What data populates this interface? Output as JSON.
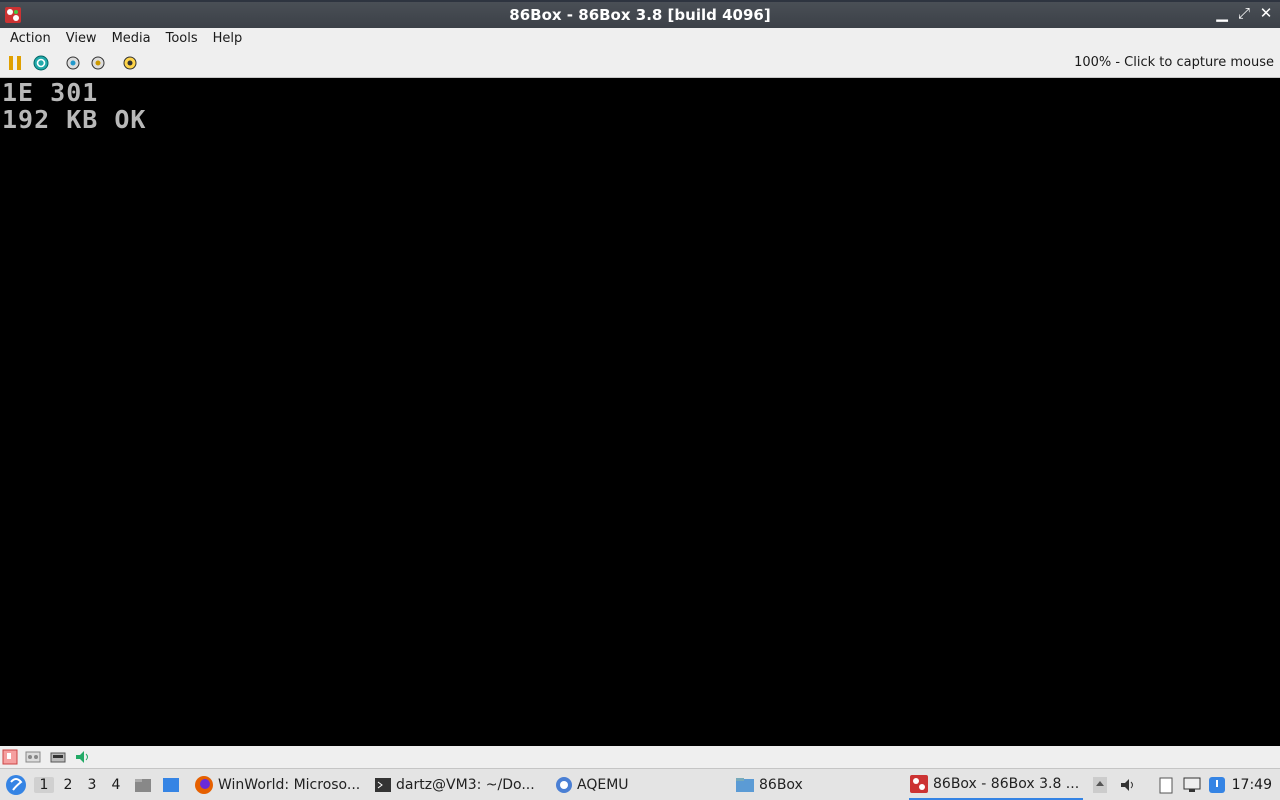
{
  "window": {
    "title": "86Box - 86Box 3.8 [build 4096]"
  },
  "menu": [
    "Action",
    "View",
    "Media",
    "Tools",
    "Help"
  ],
  "toolbar": {
    "status": "100% - Click to capture mouse"
  },
  "screen": {
    "lines": [
      "1E 301",
      "192 KB OK"
    ]
  },
  "taskbar": {
    "workspaces": [
      "1",
      "2",
      "3",
      "4"
    ],
    "active_workspace": "1",
    "tasks": [
      {
        "label": "WinWorld: Microso...",
        "icon": "firefox-icon"
      },
      {
        "label": "dartz@VM3: ~/Do...",
        "icon": "terminal-icon"
      },
      {
        "label": "AQEMU",
        "icon": "aqemu-icon"
      },
      {
        "label": "86Box",
        "icon": "folder-icon"
      },
      {
        "label": "86Box - 86Box 3.8 ...",
        "icon": "86box-icon"
      }
    ],
    "clock": "17:49"
  },
  "colors": {
    "accent": "#3584e4",
    "screen_text": "#b8b8b8"
  }
}
